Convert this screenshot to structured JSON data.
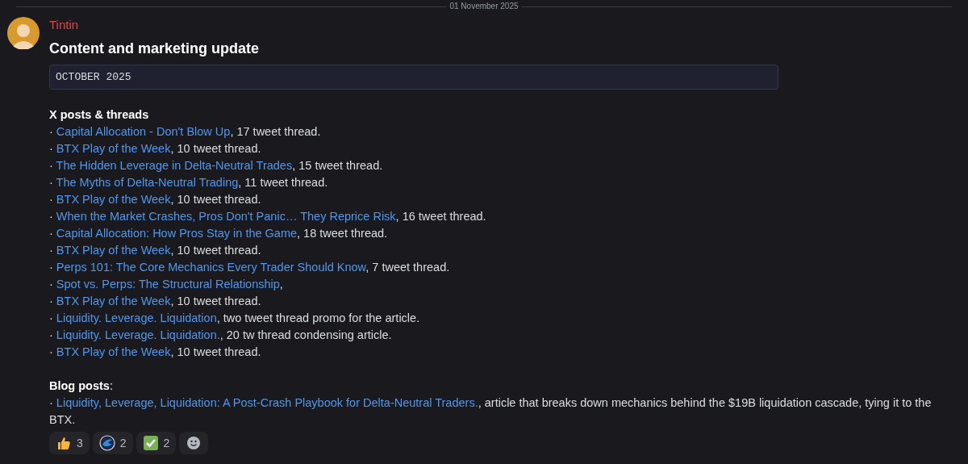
{
  "divider": {
    "date": "01 November 2025"
  },
  "message": {
    "author": "Tintin",
    "title": "Content and marketing update",
    "code_block": "OCTOBER 2025",
    "bullet": "·",
    "sections": [
      {
        "heading": "X posts & threads",
        "items": [
          {
            "link": "Capital Allocation - Don't Blow Up",
            "text": ", 17 tweet thread."
          },
          {
            "link": "BTX Play of the Week",
            "text": ", 10 tweet thread."
          },
          {
            "link": "The Hidden Leverage in Delta-Neutral Trades",
            "text": ", 15 tweet thread."
          },
          {
            "link": "The Myths of Delta-Neutral Trading",
            "text": ", 11 tweet thread."
          },
          {
            "link": "BTX Play of the Week",
            "text": ", 10 tweet thread."
          },
          {
            "link": "When the Market Crashes, Pros Don't Panic… They Reprice Risk",
            "text": ", 16 tweet thread."
          },
          {
            "link": "Capital Allocation: How Pros Stay in the Game",
            "text": ", 18 tweet thread."
          },
          {
            "link": "BTX Play of the Week",
            "text": ", 10 tweet thread."
          },
          {
            "link": "Perps 101: The Core Mechanics Every Trader Should Know",
            "text": ", 7 tweet thread."
          },
          {
            "link": "Spot vs. Perps: The Structural Relationship",
            "text": ","
          },
          {
            "link": "BTX Play of the Week",
            "text": ", 10 tweet thread."
          },
          {
            "link": "Liquidity. Leverage. Liquidation",
            "text": ", two tweet thread promo for the article."
          },
          {
            "link": "Liquidity. Leverage. Liquidation.",
            "text": ", 20 tw thread condensing article."
          },
          {
            "link": "BTX Play of the Week",
            "text": ", 10 tweet thread."
          }
        ]
      },
      {
        "heading": "**Blog posts**:",
        "items": [
          {
            "link": "Liquidity, Leverage, Liquidation: A Post-Crash Playbook for Delta-Neutral Traders.",
            "text": ", article that breaks down mechanics behind the $19B liquidation cascade, tying it to the BTX."
          }
        ]
      }
    ],
    "reactions": [
      {
        "kind": "thumbs-up",
        "count": "3"
      },
      {
        "kind": "logo",
        "count": "2"
      },
      {
        "kind": "check",
        "count": "2"
      }
    ]
  }
}
